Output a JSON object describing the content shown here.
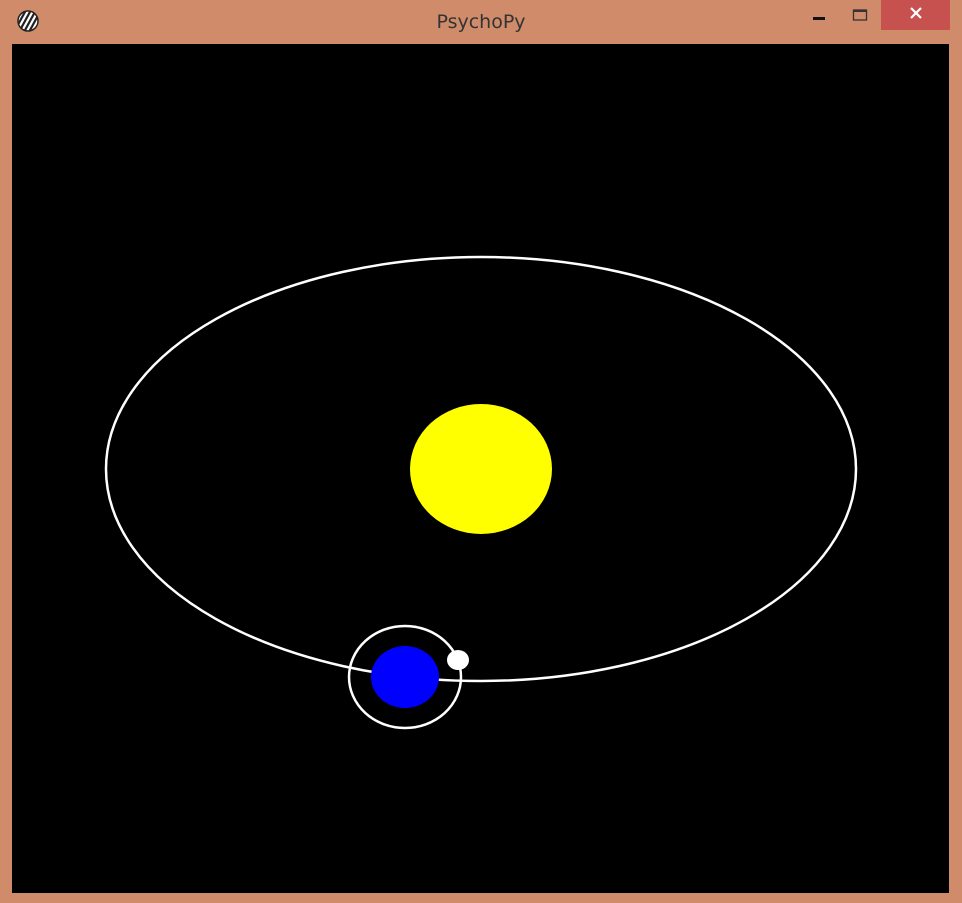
{
  "window": {
    "title": "PsychoPy",
    "frame_color": "#d08c6a",
    "close_color": "#c7514f"
  },
  "icons": {
    "app": "psychopy-logo-icon",
    "minimize": "minimize-icon",
    "maximize": "maximize-icon",
    "close": "close-icon"
  },
  "scene": {
    "background": "#000000",
    "sun_color": "#ffff00",
    "planet_color": "#0000ff",
    "moon_color": "#ffffff",
    "orbit_color": "#ffffff"
  }
}
